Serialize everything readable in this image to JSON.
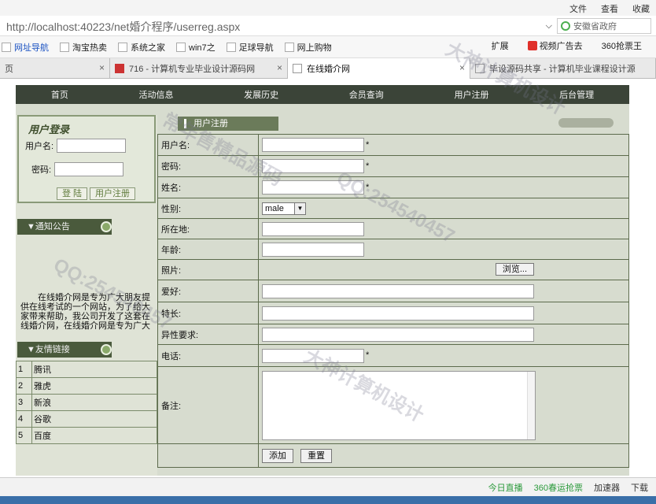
{
  "browser": {
    "menu": [
      "文件",
      "查看",
      "收藏"
    ],
    "address": "http://localhost:40223/net婚介程序/userreg.aspx",
    "address_host": "localhost",
    "search_text": "安徽省政府",
    "bookmarks": [
      "网址导航",
      "淘宝热卖",
      "系统之家",
      "win7之",
      "足球导航",
      "网上购物"
    ],
    "bookmarks_right": [
      "扩展",
      "视频广告去",
      "360抢票王"
    ],
    "tabs": [
      {
        "label": "页"
      },
      {
        "label": "716 - 计算机专业毕业设计源码网"
      },
      {
        "label": "在线婚介网"
      },
      {
        "label": "毕设源码共享 - 计算机毕业课程设计源"
      }
    ],
    "status_items": [
      "今日直播",
      "360春运抢票",
      "加速器",
      "下载"
    ]
  },
  "nav": [
    "首页",
    "活动信息",
    "发展历史",
    "会员查询",
    "用户注册",
    "后台管理"
  ],
  "login": {
    "title": "用户登录",
    "username_label": "用户名:",
    "password_label": "密码:",
    "login_button": "登 陆",
    "register_button": "用户注册"
  },
  "notice": {
    "heading": "▼通知公告",
    "text": "在线婚介网是专为广大朋友提供在线考试的一个网站，为了给大家带来帮助，我公司开发了这套在线婚介网，在线婚介网是专为广大朋"
  },
  "links": {
    "heading": "▼友情链接",
    "items": [
      {
        "num": "1",
        "name": "腾讯"
      },
      {
        "num": "2",
        "name": "雅虎"
      },
      {
        "num": "3",
        "name": "新浪"
      },
      {
        "num": "4",
        "name": "谷歌"
      },
      {
        "num": "5",
        "name": "百度"
      }
    ]
  },
  "form": {
    "section_title": "用户注册",
    "fields": {
      "username": "用户名:",
      "password": "密码:",
      "name": "姓名:",
      "gender": "性别:",
      "location": "所在地:",
      "age": "年龄:",
      "photo": "照片:",
      "hobby": "爱好:",
      "specialty": "特长:",
      "requirement": "异性要求:",
      "phone": "电话:",
      "remark": "备注:"
    },
    "required_mark": "*",
    "gender_value": "male",
    "browse_button": "浏览...",
    "add_button": "添加",
    "reset_button": "重置"
  },
  "watermarks": [
    "常年售精品源码",
    "QQ:254540457",
    "大神计算机设计"
  ]
}
